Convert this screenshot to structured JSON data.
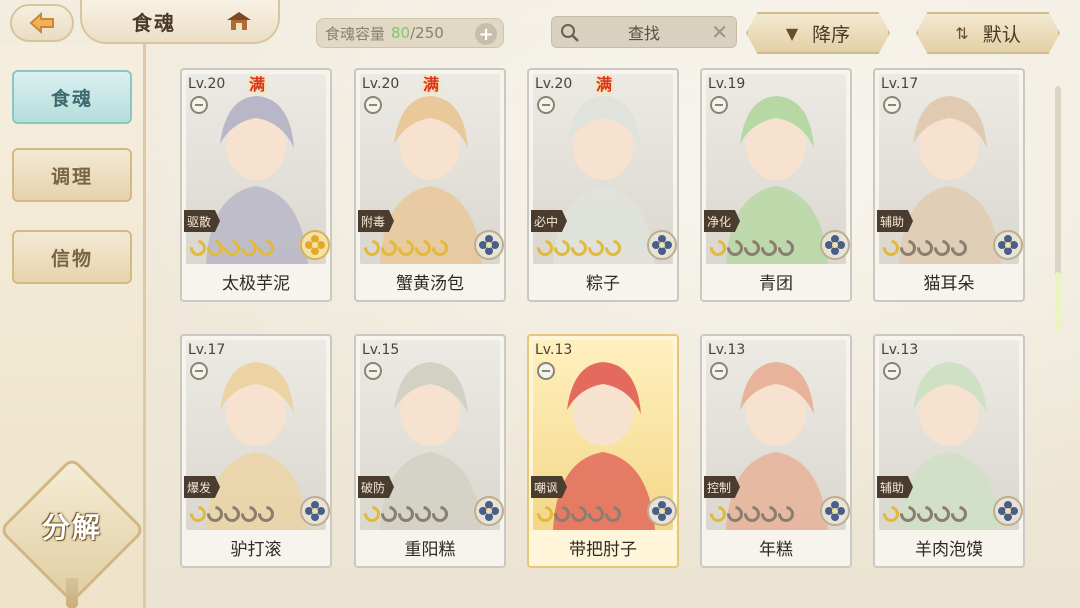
{
  "header": {
    "title": "食魂",
    "capacity_label": "食魂容量",
    "capacity_current": "80",
    "capacity_sep": "/",
    "capacity_max": "250",
    "search_label": "查找",
    "sort_desc_label": "降序",
    "sort_default_label": "默认"
  },
  "sidebar": {
    "tabs": [
      {
        "label": "食魂",
        "active": true
      },
      {
        "label": "调理",
        "active": false
      },
      {
        "label": "信物",
        "active": false
      }
    ],
    "decompose_label": "分解"
  },
  "cards": [
    {
      "level": "Lv.20",
      "full": "满",
      "role": "驱散",
      "name": "太极芋泥",
      "stars": 5,
      "badge": "gold-flower",
      "rarity": "normal"
    },
    {
      "level": "Lv.20",
      "full": "满",
      "role": "附毒",
      "name": "蟹黄汤包",
      "stars": 5,
      "badge": "blue-flower",
      "rarity": "normal"
    },
    {
      "level": "Lv.20",
      "full": "满",
      "role": "必中",
      "name": "粽子",
      "stars": 5,
      "badge": "blue-flower",
      "rarity": "normal"
    },
    {
      "level": "Lv.19",
      "full": "",
      "role": "净化",
      "name": "青团",
      "stars": 1,
      "badge": "blue-flower",
      "rarity": "normal"
    },
    {
      "level": "Lv.17",
      "full": "",
      "role": "辅助",
      "name": "猫耳朵",
      "stars": 1,
      "badge": "blue-flower",
      "rarity": "normal"
    },
    {
      "level": "Lv.17",
      "full": "",
      "role": "爆发",
      "name": "驴打滚",
      "stars": 1,
      "badge": "blue-flower",
      "rarity": "normal"
    },
    {
      "level": "Lv.15",
      "full": "",
      "role": "破防",
      "name": "重阳糕",
      "stars": 1,
      "badge": "blue-flower",
      "rarity": "normal"
    },
    {
      "level": "Lv.13",
      "full": "",
      "role": "嘲讽",
      "name": "带把肘子",
      "stars": 1,
      "badge": "blue-flower",
      "rarity": "gold"
    },
    {
      "level": "Lv.13",
      "full": "",
      "role": "控制",
      "name": "年糕",
      "stars": 1,
      "badge": "blue-flower",
      "rarity": "normal"
    },
    {
      "level": "Lv.13",
      "full": "",
      "role": "辅助",
      "name": "羊肉泡馍",
      "stars": 1,
      "badge": "blue-flower",
      "rarity": "normal"
    }
  ]
}
